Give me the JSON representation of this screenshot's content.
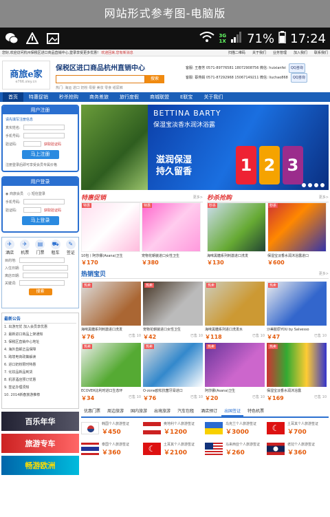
{
  "titlebar": "网站形式参考图-电脑版",
  "status": {
    "battery": "71%",
    "time": "17:24",
    "net_top": "3G",
    "net_bot": "1X"
  },
  "topnav": {
    "left": "您好,欢迎访问杭州保税区进口商品直销中心,登录享受更多优惠!",
    "welcome": "欢迎回来,您有新消息",
    "right": [
      "扫描二维码",
      "关于我们",
      "业务管理",
      "加入我们",
      "联系我们"
    ]
  },
  "logo": {
    "line1": "商旅e家",
    "line2": "e766.sley.cn"
  },
  "header": {
    "title": "保税区进口商品杭州直销中心",
    "search_placeholder": "",
    "search_btn": "搜索",
    "hot": "热门:  海运    进口    奶粉    母婴    美妆    零食    纸尿裤"
  },
  "contact": {
    "l1": "客服: 王春芳  0571-89776581   18072908756   微信: huixianfei",
    "l2": "客服: 蔡燕娟  0571-87292968   15067149211   微信: liuchao868",
    "qq1": "QQ咨询",
    "qq2": "QQ咨询"
  },
  "mainnav": [
    "首页",
    "特惠促销",
    "秒杀抢购",
    "商务差旅",
    "旅行度假",
    "商城联盟",
    "E联宝",
    "关于我们"
  ],
  "reg": {
    "title": "用户注册",
    "hint": "请先填写注册信息",
    "f1": "真实姓名:",
    "f2": "手机号码:",
    "f3": "验证码:",
    "code_link": "获取验证码",
    "btn": "马上注册",
    "note": "注册登录后即可享受会员专属价格"
  },
  "login": {
    "title": "用户登录",
    "opt1": "商旅会员",
    "opt2": "短信登录",
    "f1": "手机号码:",
    "f2": "验证码:",
    "code_link": "获取验证码",
    "btn": "马上登录"
  },
  "tabs": [
    {
      "i": "✈",
      "l": "酒店"
    },
    {
      "i": "✈",
      "l": "机票"
    },
    {
      "i": "▤",
      "l": "门票"
    },
    {
      "i": "⛟",
      "l": "租车"
    },
    {
      "i": "✎",
      "l": "签证"
    }
  ],
  "hotel": {
    "r1": "目的地:",
    "r2": "入住日期:",
    "r3": "离店日期:",
    "r4": "关键词:",
    "btn": "搜索"
  },
  "news": {
    "title": "最新公告",
    "items": [
      "1. 出游无忧 加入会员享优惠",
      "2. 最新进口商品上架通知",
      "3. 保税区直销中心地址",
      "4. 海外直邮正品保障",
      "5. 跨境电商政策解读",
      "6. 进口奶粉限时特惠",
      "7. 化妆品新品到货",
      "8. 机票酒店预订优惠",
      "9. 签证办理须知",
      "10. 2014新春旅游推荐"
    ]
  },
  "banners": [
    "百乐年华",
    "旅游专车",
    "畅游欧洲"
  ],
  "hero": {
    "brand": "BETTINA BARTY",
    "sub": "保湿宝淡香水润沐浴露",
    "slogan1": "滋润保湿",
    "slogan2": "持久留香"
  },
  "sec1": {
    "title": "特惠促销",
    "more": "更多>",
    "items": [
      {
        "name": "10包丨阿莎娜(Asana)卫生",
        "price": "￥170",
        "tag": "特惠"
      },
      {
        "name": "宠物花朝装进口女性卫生",
        "price": "￥380",
        "tag": "特惠"
      }
    ]
  },
  "sec2": {
    "title": "秒杀抢购",
    "more": "更多>",
    "items": [
      {
        "name": "海味黑糖系列刺激进口洗发",
        "price": "￥130",
        "tag": "秒杀"
      },
      {
        "name": "保湿宝淡香水润沐浴露进口",
        "price": "￥600",
        "tag": "秒杀"
      }
    ]
  },
  "sec3": {
    "title": "热销宝贝",
    "more": "更多>",
    "items": [
      {
        "name": "海味黑糖系列刺激进口洗发",
        "price": "￥76"
      },
      {
        "name": "宠物花朝装进口女性卫生",
        "price": "￥42"
      },
      {
        "name": "海味黑糖系列进口洗发水",
        "price": "￥118"
      },
      {
        "name": "沙美胶原YOU by Salvesso",
        "price": "￥47"
      },
      {
        "name": "ECOVER比利时进口生态环",
        "price": "￥34"
      },
      {
        "name": "O-zone欧松抗菌牙膏进口",
        "price": "￥76"
      },
      {
        "name": "阿莎娜(Asana)卫生",
        "price": "￥20"
      },
      {
        "name": "保湿宝淡香水润沐浴露",
        "price": "￥169"
      }
    ],
    "hot_label": "热卖",
    "sold": "已售 10"
  },
  "visa": {
    "tabs": [
      "优惠门票",
      "周边旅游",
      "国内旅游",
      "出境旅游",
      "汽车包租",
      "酒店预订",
      "出国签证",
      "特色机票"
    ],
    "active": 6,
    "items": [
      {
        "c": "韩国个人旅游签证",
        "p": "￥450"
      },
      {
        "c": "奥地利个人旅游签证",
        "p": "￥1200"
      },
      {
        "c": "乌克兰个人旅游签证",
        "p": "￥3000"
      },
      {
        "c": "土耳其个人旅游签证",
        "p": "￥700"
      },
      {
        "c": "泰国个人旅游签证",
        "p": "￥360"
      },
      {
        "c": "土耳其个人旅游签证",
        "p": "￥2100"
      },
      {
        "c": "马来西亚个人旅游签证",
        "p": "￥260"
      },
      {
        "c": "老挝个人旅游签证",
        "p": "￥360"
      }
    ]
  }
}
